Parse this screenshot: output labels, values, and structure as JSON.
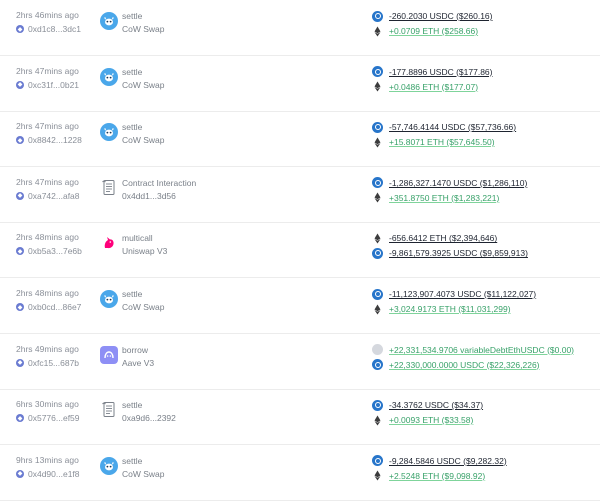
{
  "colors": {
    "positive": "#38a169",
    "negative": "#1e2430",
    "muted": "#8a8f98",
    "usdc": "#2775ca",
    "cow": "#4aa7ea",
    "aave": "#8e8ff5"
  },
  "transactions": [
    {
      "time": "2hrs 46mins ago",
      "address": "0xd1c8...3dc1",
      "icon": "cow-swap-icon",
      "method": "settle",
      "protocol": "CoW Swap",
      "line1": {
        "token": "usdc",
        "text": "-260.2030 USDC ($260.16)",
        "sign": "neg"
      },
      "line2": {
        "token": "eth",
        "text": "+0.0709 ETH ($258.66)",
        "sign": "pos"
      }
    },
    {
      "time": "2hrs 47mins ago",
      "address": "0xc31f...0b21",
      "icon": "cow-swap-icon",
      "method": "settle",
      "protocol": "CoW Swap",
      "line1": {
        "token": "usdc",
        "text": "-177.8896 USDC ($177.86)",
        "sign": "neg"
      },
      "line2": {
        "token": "eth",
        "text": "+0.0486 ETH ($177.07)",
        "sign": "pos"
      }
    },
    {
      "time": "2hrs 47mins ago",
      "address": "0x8842...1228",
      "icon": "cow-swap-icon",
      "method": "settle",
      "protocol": "CoW Swap",
      "line1": {
        "token": "usdc",
        "text": "-57,746.4144 USDC ($57,736.66)",
        "sign": "neg"
      },
      "line2": {
        "token": "eth",
        "text": "+15.8071 ETH ($57,645.50)",
        "sign": "pos"
      }
    },
    {
      "time": "2hrs 47mins ago",
      "address": "0xa742...afa8",
      "icon": "contract-document-icon",
      "method": "Contract Interaction",
      "protocol": "0x4dd1...3d56",
      "line1": {
        "token": "usdc",
        "text": "-1,286,327.1470 USDC ($1,286,110)",
        "sign": "neg"
      },
      "line2": {
        "token": "eth",
        "text": "+351.8750 ETH ($1,283,221)",
        "sign": "pos"
      }
    },
    {
      "time": "2hrs 48mins ago",
      "address": "0xb5a3...7e6b",
      "icon": "uniswap-unicorn-icon",
      "method": "multicall",
      "protocol": "Uniswap V3",
      "line1": {
        "token": "eth",
        "text": "-656.6412 ETH ($2,394,646)",
        "sign": "neg"
      },
      "line2": {
        "token": "usdc",
        "text": "-9,861,579.3925 USDC ($9,859,913)",
        "sign": "neg"
      }
    },
    {
      "time": "2hrs 48mins ago",
      "address": "0xb0cd...86e7",
      "icon": "cow-swap-icon",
      "method": "settle",
      "protocol": "CoW Swap",
      "line1": {
        "token": "usdc",
        "text": "-11,123,907.4073 USDC ($11,122,027)",
        "sign": "neg"
      },
      "line2": {
        "token": "eth",
        "text": "+3,024.9173 ETH ($11,031,299)",
        "sign": "pos"
      }
    },
    {
      "time": "2hrs 49mins ago",
      "address": "0xfc15...687b",
      "icon": "aave-ghost-icon",
      "method": "borrow",
      "protocol": "Aave V3",
      "line1": {
        "token": "gray",
        "text": "+22,331,534.9706 variableDebtEthUSDC ($0.00)",
        "sign": "pos"
      },
      "line2": {
        "token": "usdc",
        "text": "+22,330,000.0000 USDC ($22,326,226)",
        "sign": "pos"
      }
    },
    {
      "time": "6hrs 30mins ago",
      "address": "0x5776...ef59",
      "icon": "contract-document-icon",
      "method": "settle",
      "protocol": "0xa9d6...2392",
      "line1": {
        "token": "usdc",
        "text": "-34.3762 USDC ($34.37)",
        "sign": "neg"
      },
      "line2": {
        "token": "eth",
        "text": "+0.0093 ETH ($33.58)",
        "sign": "pos"
      }
    },
    {
      "time": "9hrs 13mins ago",
      "address": "0x4d90...e1f8",
      "icon": "cow-swap-icon",
      "method": "settle",
      "protocol": "CoW Swap",
      "line1": {
        "token": "usdc",
        "text": "-9,284.5846 USDC ($9,282.32)",
        "sign": "neg"
      },
      "line2": {
        "token": "eth",
        "text": "+2.5248 ETH ($9,098.92)",
        "sign": "pos"
      }
    }
  ]
}
